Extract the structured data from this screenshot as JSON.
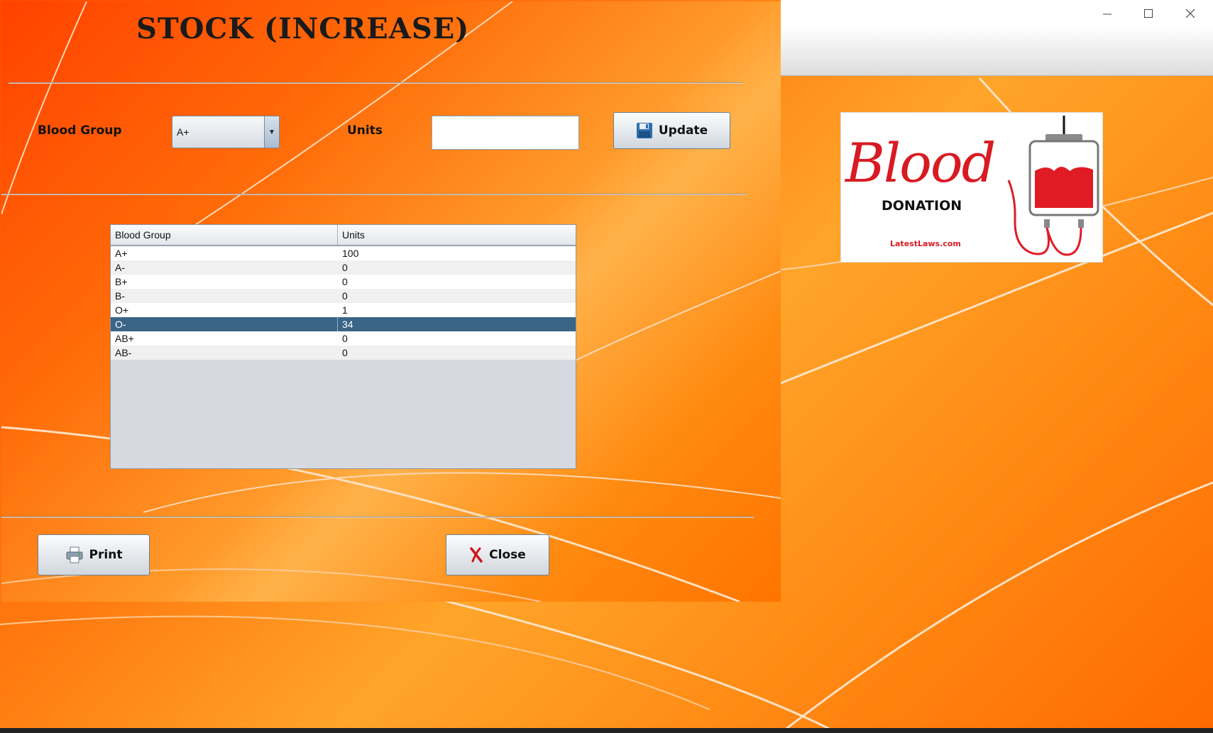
{
  "window": {
    "controls": [
      "minimize",
      "maximize",
      "close"
    ]
  },
  "heading": "STOCK (INCREASE)",
  "form": {
    "blood_group_label": "Blood Group",
    "blood_group_value": "A+",
    "units_label": "Units",
    "units_value": "",
    "update_label": "Update"
  },
  "table": {
    "columns": [
      "Blood Group",
      "Units"
    ],
    "rows": [
      {
        "group": "A+",
        "units": "100"
      },
      {
        "group": "A-",
        "units": "0"
      },
      {
        "group": "B+",
        "units": "0"
      },
      {
        "group": "B-",
        "units": "0"
      },
      {
        "group": "O+",
        "units": "1"
      },
      {
        "group": "O-",
        "units": "34",
        "selected": true
      },
      {
        "group": "AB+",
        "units": "0"
      },
      {
        "group": "AB-",
        "units": "0"
      }
    ]
  },
  "buttons": {
    "print_label": "Print",
    "close_label": "Close"
  },
  "logo": {
    "script_text": "Blood",
    "donation_text": "DONATION",
    "site_text": "LatestLaws.com"
  },
  "icons": {
    "update": "floppy-disk-icon",
    "print": "printer-icon",
    "close": "red-x-icon"
  },
  "colors": {
    "selected_row": "#3b6586",
    "background_orange": "#ff7a10",
    "logo_red": "#d81a22"
  }
}
